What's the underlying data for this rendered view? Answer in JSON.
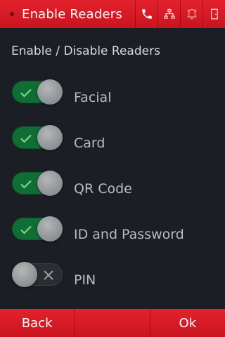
{
  "header": {
    "title": "Enable Readers",
    "icons": [
      "phone-icon",
      "network-icon",
      "bell-icon",
      "exit-door-icon"
    ]
  },
  "section_title": "Enable / Disable Readers",
  "readers": [
    {
      "label": "Facial",
      "enabled": true
    },
    {
      "label": "Card",
      "enabled": true
    },
    {
      "label": "QR Code",
      "enabled": true
    },
    {
      "label": "ID and Password",
      "enabled": true
    },
    {
      "label": "PIN",
      "enabled": false
    }
  ],
  "footer": {
    "back_label": "Back",
    "ok_label": "Ok"
  },
  "colors": {
    "header_red": "#d71a25",
    "background": "#1b1f25",
    "toggle_on": "#0f6e33",
    "check_green": "#7cd685"
  }
}
